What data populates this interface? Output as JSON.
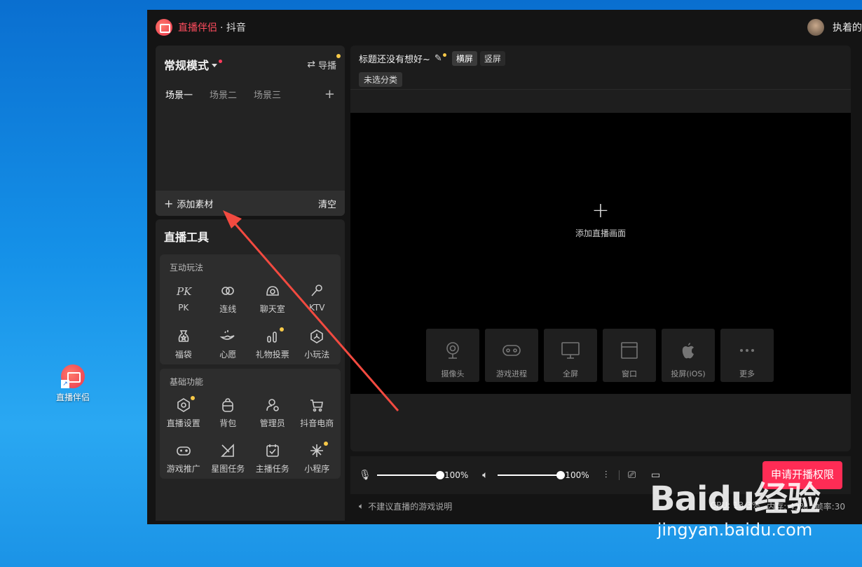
{
  "desktop": {
    "icon_label": "直播伴侣"
  },
  "app": {
    "name": "直播伴侣",
    "platform": "· 抖音",
    "user": "执着的"
  },
  "scene_panel": {
    "mode": "常规模式",
    "director": "导播",
    "tabs": [
      "场景一",
      "场景二",
      "场景三"
    ],
    "add_material": "添加素材",
    "clear": "清空"
  },
  "tools": {
    "title": "直播工具",
    "groups": [
      {
        "label": "互动玩法",
        "items": [
          {
            "label": "PK",
            "icon": "pk-icon"
          },
          {
            "label": "连线",
            "icon": "link-icon"
          },
          {
            "label": "聊天室",
            "icon": "chatroom-icon"
          },
          {
            "label": "KTV",
            "icon": "microphone-icon"
          },
          {
            "label": "福袋",
            "icon": "lucky-bag-icon"
          },
          {
            "label": "心愿",
            "icon": "wish-lamp-icon"
          },
          {
            "label": "礼物投票",
            "icon": "gift-vote-icon"
          },
          {
            "label": "小玩法",
            "icon": "mini-game-icon"
          }
        ]
      },
      {
        "label": "基础功能",
        "items": [
          {
            "label": "直播设置",
            "icon": "settings-icon"
          },
          {
            "label": "背包",
            "icon": "backpack-icon"
          },
          {
            "label": "管理员",
            "icon": "admin-icon"
          },
          {
            "label": "抖音电商",
            "icon": "cart-icon"
          },
          {
            "label": "游戏推广",
            "icon": "gamepad-icon"
          },
          {
            "label": "星图任务",
            "icon": "star-map-icon"
          },
          {
            "label": "主播任务",
            "icon": "task-icon"
          },
          {
            "label": "小程序",
            "icon": "mini-program-icon"
          }
        ]
      }
    ]
  },
  "stream": {
    "title": "标题还没有想好~",
    "orientation": [
      "横屏",
      "竖屏"
    ],
    "category": "未选分类",
    "add_view": "添加直播画面",
    "sources": [
      {
        "label": "摄像头",
        "icon": "camera-icon"
      },
      {
        "label": "游戏进程",
        "icon": "game-process-icon"
      },
      {
        "label": "全屏",
        "icon": "fullscreen-icon"
      },
      {
        "label": "窗口",
        "icon": "window-icon"
      },
      {
        "label": "投屏(iOS)",
        "icon": "apple-icon"
      },
      {
        "label": "更多",
        "icon": "more-icon"
      }
    ]
  },
  "controls": {
    "mic_volume": "100%",
    "speaker_volume": "100%",
    "mic_level": 1.0,
    "speaker_level": 1.0,
    "apply_button": "申请开播权限"
  },
  "status": {
    "notice": "不建议直播的游戏说明",
    "cpu": "CPU: 13.3%",
    "memory": "内存: 43%",
    "fps": "帧率:30"
  },
  "watermark": {
    "logo": "Baidu经验",
    "url": "jingyan.baidu.com"
  },
  "colors": {
    "accent": "#fe2c55",
    "badge": "#f7c948",
    "bg": "#141414"
  }
}
